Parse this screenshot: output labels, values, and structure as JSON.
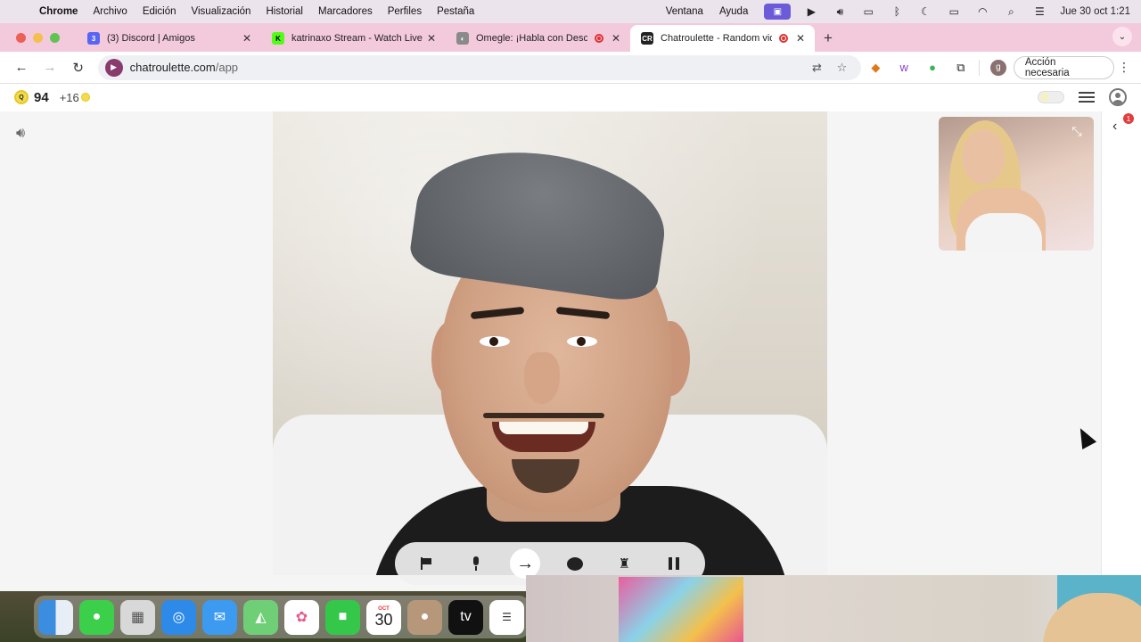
{
  "menubar": {
    "app_name": "Chrome",
    "menus": [
      "Archivo",
      "Edición",
      "Visualización",
      "Historial",
      "Marcadores",
      "Perfiles",
      "Pestaña"
    ],
    "right_menus": [
      "Ventana",
      "Ayuda"
    ],
    "clock": "Jue 30 oct  1:21"
  },
  "tabs": [
    {
      "title": "(3) Discord | Amigos",
      "favicon_color": "#5865f2",
      "favicon_text": "3",
      "recording": false
    },
    {
      "title": "katrinaxo Stream - Watch Live",
      "favicon_color": "#53fc18",
      "favicon_text": "K",
      "recording": false
    },
    {
      "title": "Omegle: ¡Habla con Desconocidos",
      "favicon_color": "#8a8a8a",
      "favicon_text": "◐",
      "recording": true
    },
    {
      "title": "Chatroulette - Random video",
      "favicon_color": "#222222",
      "favicon_text": "CR",
      "recording": true,
      "active": true
    }
  ],
  "toolbar": {
    "url_host": "chatroulette.com",
    "url_path": "/app",
    "profile_initial": "g",
    "action_label": "Acción necesaria"
  },
  "page": {
    "coins": "94",
    "bonus": "+16",
    "coin_letter": "Q",
    "notification_count": "1"
  },
  "dock": {
    "calendar_month": "OCT",
    "calendar_day": "30",
    "apple_tv_label": "tv",
    "apps": [
      "finder-icon",
      "messages-icon",
      "launchpad-icon",
      "safari-icon",
      "mail-icon",
      "maps-icon",
      "photos-icon",
      "facetime-icon",
      "calendar-icon",
      "contacts-icon",
      "apple-tv-icon",
      "reminders-icon"
    ]
  },
  "colors": {
    "tabstrip": "#f3c9dc",
    "menubar": "#ece4ec",
    "coin": "#f1dc4b"
  }
}
